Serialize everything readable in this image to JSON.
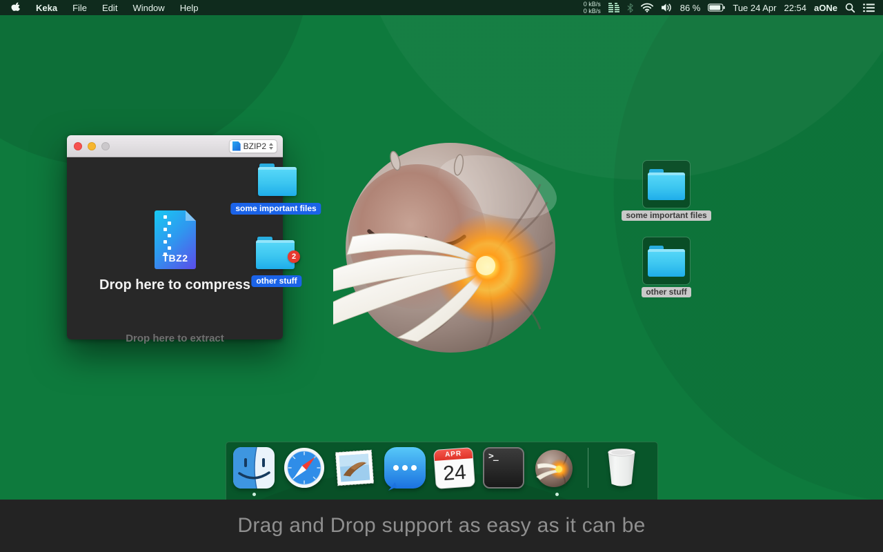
{
  "menubar": {
    "app_name": "Keka",
    "menus": [
      "File",
      "Edit",
      "Window",
      "Help"
    ],
    "status": {
      "net_up": "0 kB/s",
      "net_down": "0 kB/s",
      "battery_pct": "86 %",
      "date": "Tue 24 Apr",
      "time": "22:54",
      "input_source": "aONe"
    }
  },
  "window": {
    "format_selector": "BZIP2",
    "file_badge": "TBZ2",
    "drop_compress": "Drop here to compress",
    "drop_extract": "Drop here to extract"
  },
  "drag_items": {
    "item1_label": "some important files",
    "item2_label": "other stuff",
    "item2_badge": "2"
  },
  "desktop_items": {
    "item1_label": "some important files",
    "item2_label": "other stuff"
  },
  "dock": {
    "calendar_month": "APR",
    "calendar_day": "24",
    "terminal_prompt": ">_",
    "items": [
      "finder",
      "safari",
      "mail",
      "messages",
      "calendar",
      "terminal",
      "keka",
      "trash"
    ]
  },
  "caption": {
    "text": "Drag and Drop support as easy as it can be"
  },
  "icons": {
    "menubar": [
      "apple-logo",
      "network-meter",
      "bluetooth",
      "wifi",
      "volume",
      "battery",
      "search",
      "notification-list"
    ],
    "mascot": "keka-pillbug-eating-paper"
  },
  "colors": {
    "desktop_green": "#0e7a3d",
    "menubar_green": "#0f2b1d",
    "selection_blue": "#1b63e8",
    "folder_cyan": "#3cc6f0",
    "badge_red": "#e8392e",
    "window_dark": "#282828",
    "caption_dark": "#232323"
  }
}
